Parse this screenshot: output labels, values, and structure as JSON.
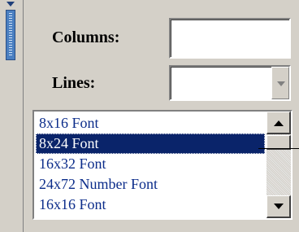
{
  "form": {
    "columns_label": "Columns:",
    "columns_value": "",
    "lines_label": "Lines:",
    "lines_value": ""
  },
  "font_list": {
    "items": [
      {
        "label": "8x16  Font",
        "selected": false
      },
      {
        "label": "8x24  Font",
        "selected": true
      },
      {
        "label": "16x32 Font",
        "selected": false
      },
      {
        "label": "24x72 Number Font",
        "selected": false
      },
      {
        "label": "16x16 Font",
        "selected": false
      }
    ]
  },
  "colors": {
    "panel_bg": "#d4d0c8",
    "selection_bg": "#0a246a",
    "item_text": "#0b2c8a"
  },
  "icons": {
    "toolbar_grip": "grip-handle-icon",
    "combo_arrow": "chevron-down-icon",
    "scroll_up": "arrow-up-icon",
    "scroll_down": "arrow-down-icon"
  }
}
